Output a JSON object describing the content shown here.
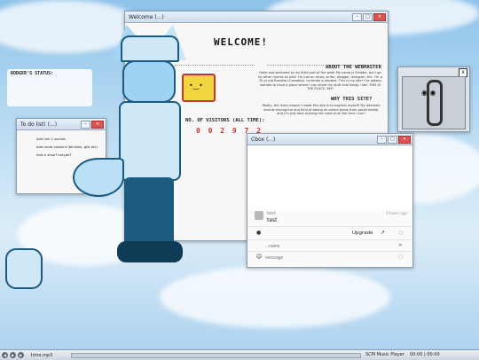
{
  "welcome": {
    "window_title": "Welcome (...)",
    "heading": "WELCOME!",
    "about_heading": "ABOUT THE WEBMASTER",
    "about_text": "Hello and welcome to my little part of the web! My name is Freddie, but I go by other names as well! I'm just an artist, writer, blogger, designer, etc. I'm a 20-yr-old Brazilian-Canadian, currently a student. This is my site! I've always wanted to have a place where I can share my stuff and things I like. THIS IS THE PLACE, YAY!",
    "why_heading": "WHY THIS SITE?",
    "why_text": "Really, the main reason I made this site is to express myself! My interests include having fun and kind of taking an online break from social media. And I'm just here making the most of all the time I can!",
    "visitors_label": "NO. OF VISITORS (ALL TIME):",
    "visitor_count": "0 0 2 9 7 2"
  },
  "status_widget": {
    "label": "RODGER'S STATUS:"
  },
  "todo": {
    "window_title": "To do list! (...)",
    "items": [
      "Add link 2 socials",
      "Add more content (blinkies, gifs etc)",
      "Add a shop? maybe?"
    ]
  },
  "clippy": {
    "close_label": "x"
  },
  "chat": {
    "window_title": "Cbox (...)",
    "message_author": "test",
    "message_text": "test",
    "message_time": "4 hours ago",
    "upgrade_label": "Upgrade",
    "name_placeholder": "...name",
    "message_placeholder": "message"
  },
  "player": {
    "track": "Intro.mp3",
    "app": "SCM Music Player",
    "time": "00:00 | 00:00"
  },
  "colors": {
    "accent": "#5fb4e8",
    "titlebar": "#cfdcec",
    "char_dark": "#1d5a80",
    "char_light": "#cfe8f7"
  }
}
